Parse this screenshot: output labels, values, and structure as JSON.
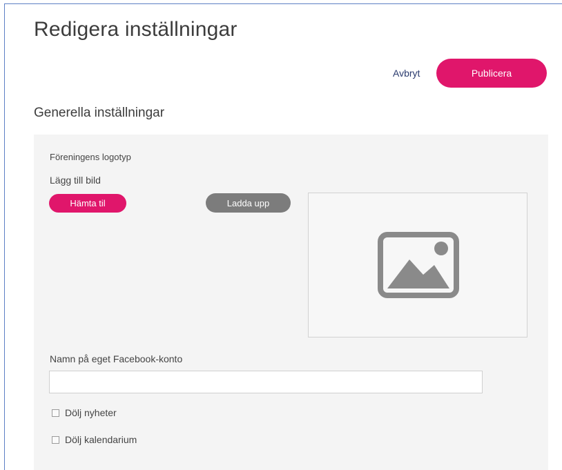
{
  "page": {
    "title": "Redigera inställningar"
  },
  "actions": {
    "cancel_label": "Avbryt",
    "publish_label": "Publicera"
  },
  "general": {
    "heading": "Generella inställningar",
    "logo_label": "Föreningens logotyp",
    "add_image_label": "Lägg till bild",
    "fetch_button_label": "Hämta til",
    "upload_button_label": "Ladda upp",
    "image_placeholder_icon": "image-placeholder-icon",
    "facebook_label": "Namn på eget Facebook-konto",
    "facebook_value": "",
    "checkboxes": [
      {
        "label": "Dölj nyheter",
        "checked": false
      },
      {
        "label": "Dölj kalendarium",
        "checked": false
      }
    ]
  },
  "colors": {
    "accent": "#e0166b",
    "secondary_button": "#7c7c7c",
    "panel_bg": "#f4f4f4"
  }
}
